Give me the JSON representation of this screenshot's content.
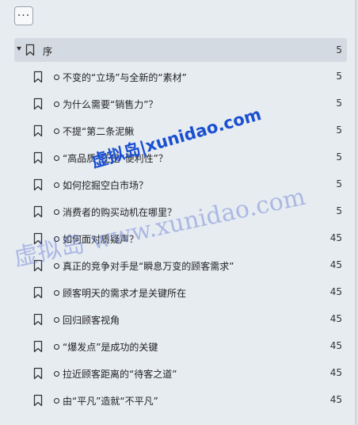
{
  "toolbar": {
    "menu_label": "···"
  },
  "toc": {
    "header": {
      "title": "序",
      "page": "5"
    },
    "items": [
      {
        "title": "不变的“立场”与全新的“素材”",
        "page": "5",
        "dot": true
      },
      {
        "title": "为什么需要“销售力”？",
        "page": "5",
        "dot": true
      },
      {
        "title": "不提“第二条泥鳅",
        "page": "5",
        "dot": true
      },
      {
        "title": "“高品质”还是“便利性”？",
        "page": "5",
        "dot": true
      },
      {
        "title": "如何挖掘空白市场？",
        "page": "5",
        "dot": true
      },
      {
        "title": "消费者的购买动机在哪里？",
        "page": "5",
        "dot": true
      },
      {
        "title": "如何面对质疑声？",
        "page": "45",
        "dot": true
      },
      {
        "title": "真正的竞争对手是“瞬息万变的顾客需求”",
        "page": "45",
        "dot": true
      },
      {
        "title": "顾客明天的需求才是关键所在",
        "page": "45",
        "dot": true
      },
      {
        "title": "回归顾客视角",
        "page": "45",
        "dot": true
      },
      {
        "title": "“爆发点”是成功的关键",
        "page": "45",
        "dot": true
      },
      {
        "title": "拉近顾客距离的“待客之道”",
        "page": "45",
        "dot": true
      },
      {
        "title": "由“平凡”造就“不平凡”",
        "page": "45",
        "dot": true
      }
    ]
  },
  "watermarks": {
    "primary": "虚拟岛|xunidao.com",
    "secondary": "虚拟岛 www.xunidao.com"
  }
}
